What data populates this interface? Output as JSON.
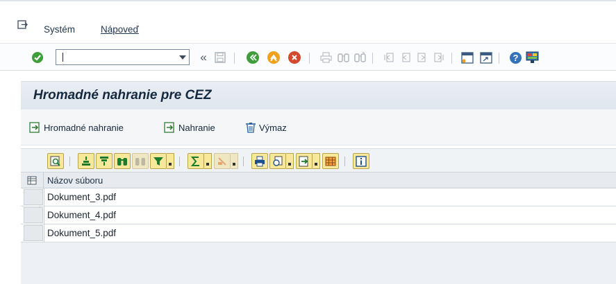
{
  "menubar": {
    "items": [
      "Systém",
      "Nápoveď"
    ]
  },
  "toolbar": {
    "command_field_value": ""
  },
  "screen": {
    "title": "Hromadné nahranie pre CEZ"
  },
  "app_toolbar": {
    "buttons": [
      "Hromadné nahranie",
      "Nahranie",
      "Výmaz"
    ]
  },
  "table": {
    "columns": [
      "Názov súboru"
    ],
    "rows": [
      "Dokument_3.pdf",
      "Dokument_4.pdf",
      "Dokument_5.pdf"
    ]
  },
  "colors": {
    "title_bg": "#e3e9ef",
    "grid_button_bg": "#f7e89a",
    "accent_green": "#3f9e3a",
    "accent_orange": "#f0a11d",
    "accent_red": "#d2492e"
  },
  "icons": {
    "toolbar": [
      "enter-check-icon",
      "command-dropdown-icon",
      "history-back-icon",
      "save-icon",
      "back-icon",
      "exit-icon",
      "cancel-icon",
      "print-icon",
      "find-icon",
      "find-next-icon",
      "first-page-icon",
      "previous-page-icon",
      "next-page-icon",
      "last-page-icon",
      "new-session-icon",
      "shortcut-icon",
      "help-icon",
      "customize-layout-icon"
    ],
    "grid": [
      "details-icon",
      "sort-ascending-icon",
      "sort-descending-icon",
      "find-icon",
      "find-next-icon",
      "filter-icon",
      "sum-icon",
      "subtotals-icon",
      "print-preview-icon",
      "export-icon",
      "layout-icon",
      "layout-grid-icon",
      "info-icon"
    ]
  }
}
